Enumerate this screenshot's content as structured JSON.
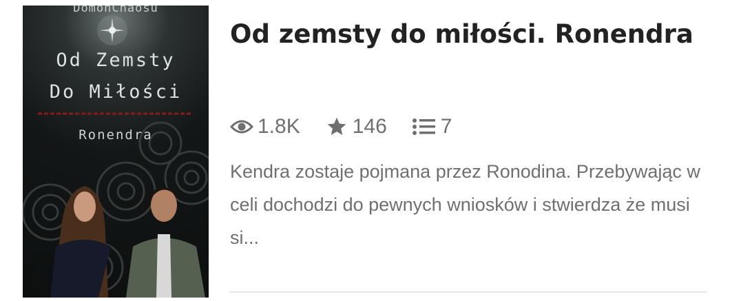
{
  "cover": {
    "author": "DomonChaosu",
    "title_line1": "Od Zemsty",
    "title_line2": "Do Miłości",
    "subtitle": "Ronendra"
  },
  "story": {
    "title": "Od zemsty do miłości. Ronendra",
    "reads": "1.8K",
    "votes": "146",
    "parts": "7",
    "description": "Kendra zostaje pojmana przez Ronodina. Przebywając w celi dochodzi do pewnych wniosków i stwierdza że musi si...",
    "icons": {
      "reads": "eye-icon",
      "votes": "star-icon",
      "parts": "list-icon"
    }
  },
  "colors": {
    "title": "#222222",
    "meta": "#6f6f6f",
    "divider": "#e6e6e6",
    "cover_accent": "#8b1a1a"
  }
}
